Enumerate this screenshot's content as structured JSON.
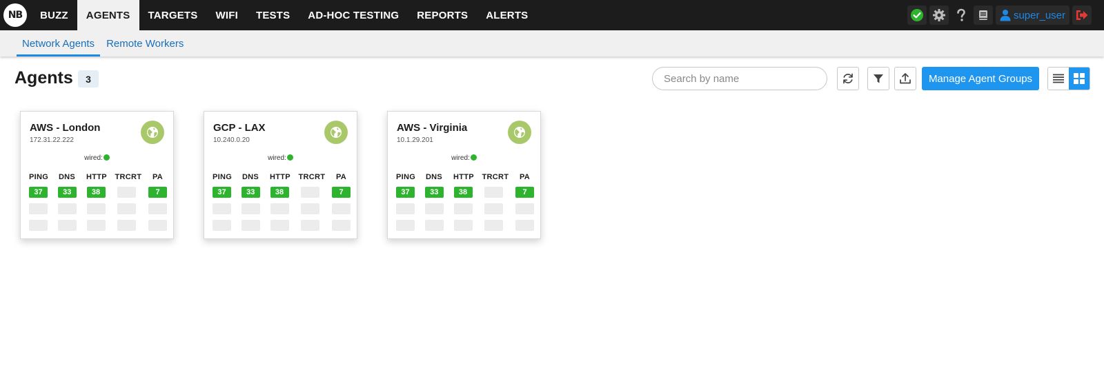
{
  "brand": {
    "logo_text": "NB"
  },
  "nav": {
    "items": [
      {
        "label": "BUZZ",
        "active": false
      },
      {
        "label": "AGENTS",
        "active": true
      },
      {
        "label": "TARGETS",
        "active": false
      },
      {
        "label": "WIFI",
        "active": false
      },
      {
        "label": "TESTS",
        "active": false
      },
      {
        "label": "AD-HOC TESTING",
        "active": false
      },
      {
        "label": "REPORTS",
        "active": false
      },
      {
        "label": "ALERTS",
        "active": false
      }
    ],
    "username": "super_user"
  },
  "subnav": {
    "tabs": [
      {
        "label": "Network Agents",
        "active": true
      },
      {
        "label": "Remote Workers",
        "active": false
      }
    ]
  },
  "page": {
    "title": "Agents",
    "count": "3",
    "search_placeholder": "Search by name",
    "manage_label": "Manage Agent Groups"
  },
  "colors": {
    "accent": "#1e96f0",
    "ok_green": "#2db32d",
    "globe_green": "#a8c86a",
    "logout_red": "#e53935"
  },
  "columns": [
    "PING",
    "DNS",
    "HTTP",
    "TRCRT",
    "PA"
  ],
  "agents": [
    {
      "name": "AWS - London",
      "ip": "172.31.22.222",
      "connection": "wired:",
      "values": [
        "37",
        "33",
        "38",
        "",
        "7"
      ]
    },
    {
      "name": "GCP - LAX",
      "ip": "10.240.0.20",
      "connection": "wired:",
      "values": [
        "37",
        "33",
        "38",
        "",
        "7"
      ]
    },
    {
      "name": "AWS - Virginia",
      "ip": "10.1.29.201",
      "connection": "wired:",
      "values": [
        "37",
        "33",
        "38",
        "",
        "7"
      ]
    }
  ]
}
